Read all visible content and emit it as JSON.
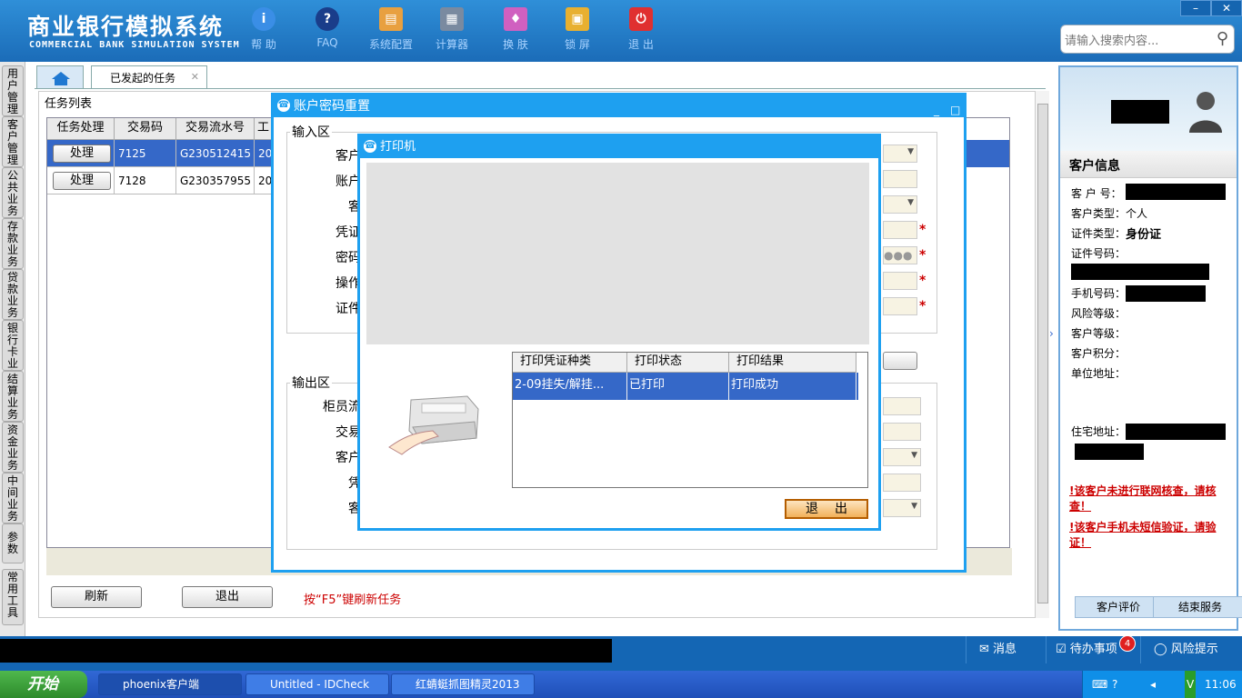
{
  "header": {
    "logo_cn": "商业银行模拟系统",
    "logo_en": "COMMERCIAL BANK SIMULATION SYSTEM",
    "toolbar": [
      {
        "label": "帮 助",
        "icon": "info-icon",
        "color": "#3a8ee6"
      },
      {
        "label": "FAQ",
        "icon": "question-icon",
        "color": "#1a3d8a"
      },
      {
        "label": "系统配置",
        "icon": "toolbox-icon",
        "color": "#e8a040"
      },
      {
        "label": "计算器",
        "icon": "calculator-icon",
        "color": "#7a8aa0"
      },
      {
        "label": "换 肤",
        "icon": "shirt-icon",
        "color": "#d060c0"
      },
      {
        "label": "锁 屏",
        "icon": "lock-icon",
        "color": "#e8b030"
      },
      {
        "label": "退 出",
        "icon": "power-icon",
        "color": "#e03030"
      }
    ],
    "search_placeholder": "请输入搜索内容..."
  },
  "left_nav": [
    "用户管理",
    "客户管理",
    "公共业务",
    "存款业务",
    "贷款业务",
    "银行卡业务",
    "结算业务",
    "资金业务",
    "中间业务",
    "参数",
    "常用工具"
  ],
  "tabs": {
    "active": "已发起的任务"
  },
  "task_list": {
    "title": "任务列表",
    "columns": [
      "任务处理",
      "交易码",
      "交易流水号",
      "工"
    ],
    "rows": [
      {
        "btn": "处理",
        "code": "7125",
        "serial": "G230512415",
        "extra": "20"
      },
      {
        "btn": "处理",
        "code": "7128",
        "serial": "G230357955",
        "extra": "20"
      }
    ]
  },
  "buttons": {
    "refresh": "刷新",
    "exit": "退出"
  },
  "hint": "按“F5”键刷新任务",
  "dialog_reset": {
    "title": "账户密码重置",
    "input_area": "输入区",
    "output_area": "输出区",
    "input_labels": [
      "客户",
      "账户",
      "客",
      "凭证",
      "密码",
      "操作",
      "证件"
    ],
    "output_labels": [
      "柜员流",
      "交易",
      "客户",
      "凭",
      "客"
    ]
  },
  "dialog_printer": {
    "title": "打印机",
    "columns": [
      "打印凭证种类",
      "打印状态",
      "打印结果"
    ],
    "rows": [
      {
        "type": "2-09挂失/解挂...",
        "status": "已打印",
        "result": "打印成功"
      }
    ],
    "exit_label": "退出"
  },
  "customer": {
    "title": "客户信息",
    "no_label": "客 户 号：",
    "type_label": "客户类型：",
    "type_value": "个人",
    "id_type_label": "证件类型：",
    "id_type_value": "身份证",
    "id_no_label": "证件号码：",
    "phone_label": "手机号码：",
    "risk_label": "风险等级：",
    "level_label": "客户等级：",
    "points_label": "客户积分：",
    "company_label": "单位地址：",
    "home_label": "住宅地址：",
    "warn1": "!该客户未进行联网核查，请核查！",
    "warn2": "!该客户手机未短信验证，请验证！",
    "eval_btn": "客户评价",
    "end_btn": "结束服务"
  },
  "statusbar": {
    "msg": "消息",
    "todo": "待办事项",
    "todo_count": "4",
    "risk": "风险提示"
  },
  "taskbar": {
    "start": "开始",
    "items": [
      "phoenix客户端",
      "Untitled - IDCheck",
      "红蜻蜓抓图精灵2013"
    ],
    "time": "11:06"
  }
}
